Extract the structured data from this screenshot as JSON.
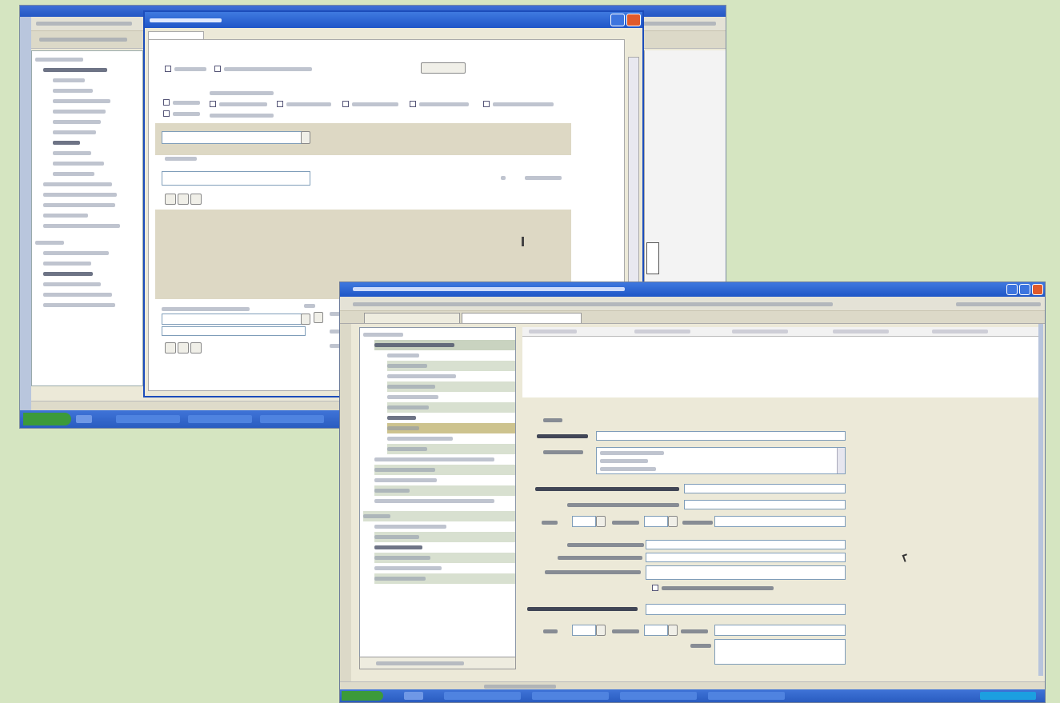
{
  "screenshots": {
    "back": {
      "window": "background-app-window",
      "dialog": "dialog-window"
    },
    "front": {
      "window": "foreground-app-window"
    }
  },
  "colors": {
    "page_background": "#d5e5c1",
    "titlebar_blue": "#2357c4",
    "taskbar_blue": "#2a5cc0",
    "start_green": "#3c9a3a",
    "close_red": "#e05a2c",
    "window_face": "#ece9d8"
  },
  "icons": [
    "close-icon",
    "minimize-icon",
    "maximize-icon",
    "dropdown-arrow-icon",
    "tree-expand-icon",
    "checkbox-icon",
    "cursor-icon"
  ]
}
